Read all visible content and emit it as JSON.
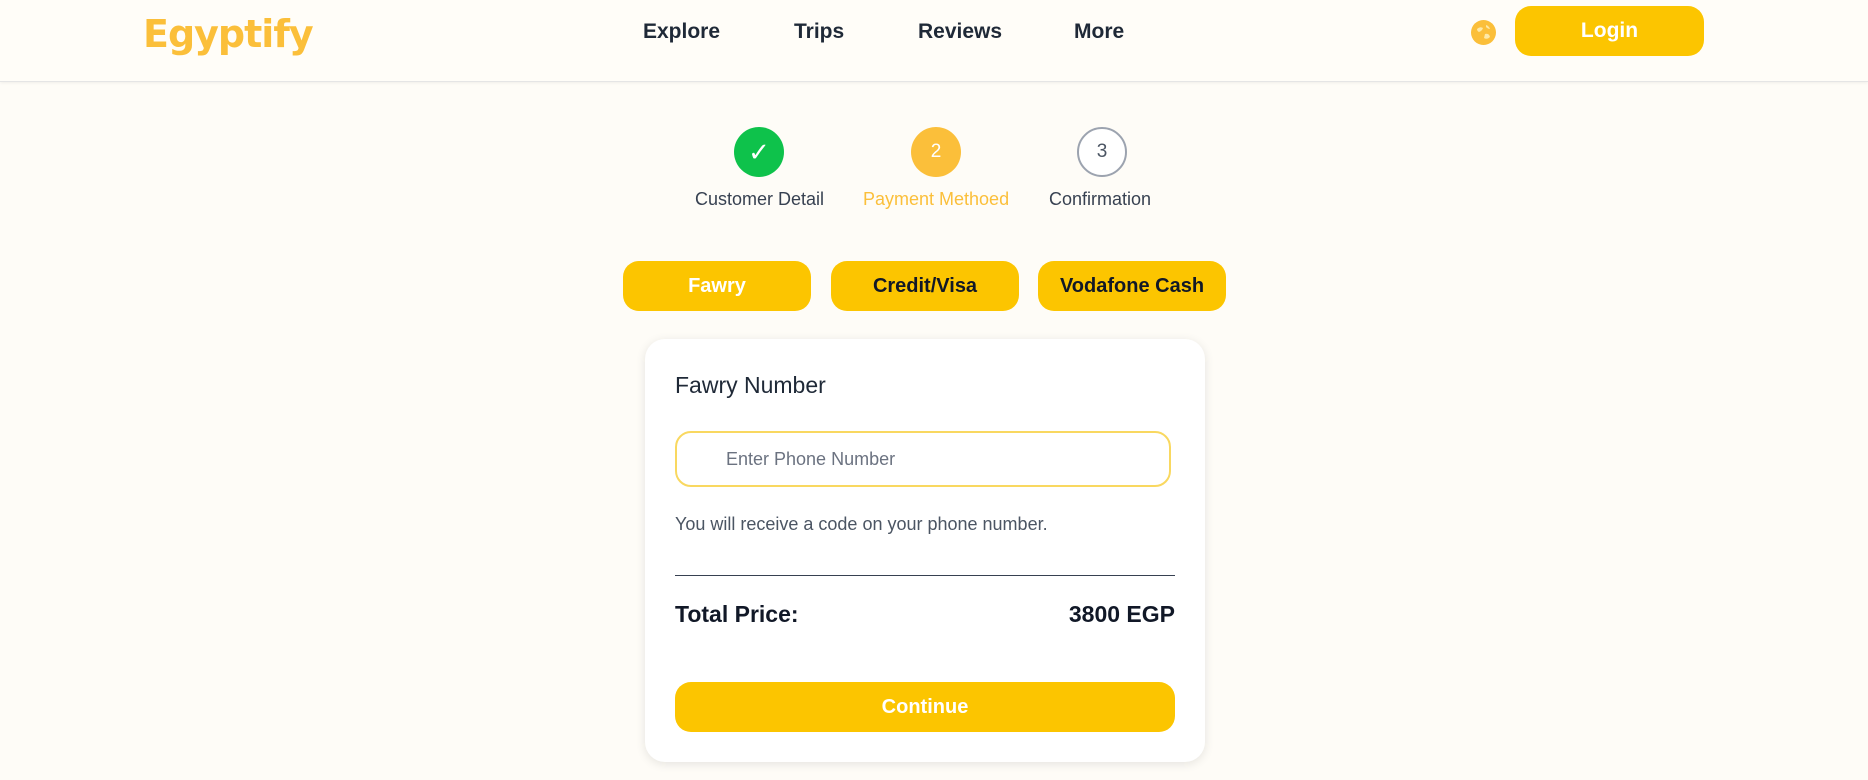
{
  "header": {
    "logo_text": "Egyptify",
    "nav": [
      {
        "label": "Explore"
      },
      {
        "label": "Trips"
      },
      {
        "label": "Reviews"
      },
      {
        "label": "More"
      }
    ],
    "language_icon": "globe-icon",
    "login_label": "Login"
  },
  "stepper": {
    "steps": [
      {
        "marker": "✓",
        "label": "Customer Detail",
        "state": "complete"
      },
      {
        "marker": "2",
        "label": "Payment Methoed",
        "state": "active"
      },
      {
        "marker": "3",
        "label": "Confirmation",
        "state": "pending"
      }
    ]
  },
  "payment_methods": [
    {
      "label": "Fawry",
      "selected": true
    },
    {
      "label": "Credit/Visa",
      "selected": false
    },
    {
      "label": "Vodafone Cash",
      "selected": false
    }
  ],
  "form": {
    "title": "Fawry Number",
    "phone_placeholder": "Enter Phone Number",
    "phone_value": "",
    "hint": "You will receive a code on your phone number.",
    "total_label": "Total Price:",
    "total_value": "3800 EGP",
    "continue_label": "Continue"
  },
  "colors": {
    "accent": "#fcc500",
    "logo": "#fbbf3a",
    "success": "#0ec24b",
    "background": "#fefcf7"
  }
}
